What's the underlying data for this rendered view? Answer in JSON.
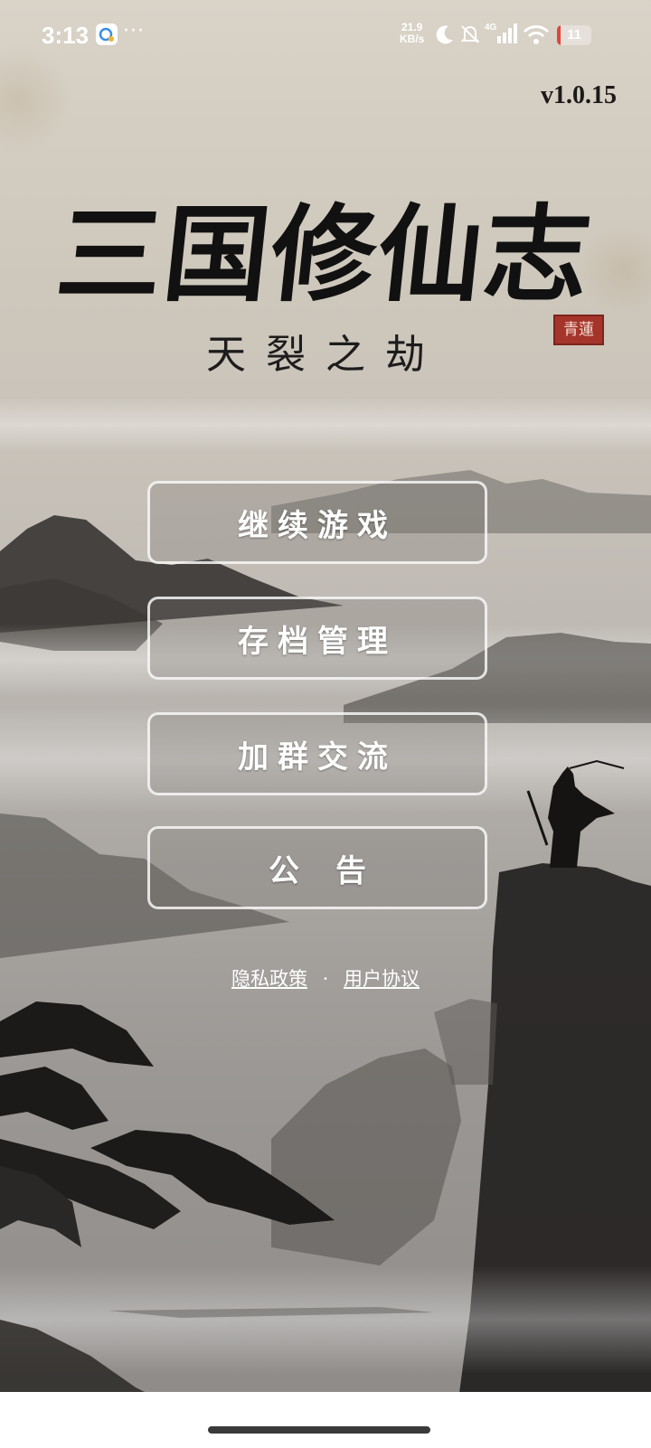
{
  "status_bar": {
    "time": "3:13",
    "dots": "···",
    "net_speed_value": "21.9",
    "net_speed_unit": "KB/s",
    "signal_label": "4G",
    "battery": "11",
    "battery_level_percent": 11,
    "battery_color": "#e0443a"
  },
  "version": "v1.0.15",
  "title": "三国修仙志",
  "subtitle": "天裂之劫",
  "seal": "青蓮",
  "menu": {
    "continue": "继续游戏",
    "saves": "存档管理",
    "join_group": "加群交流",
    "notice": "公告"
  },
  "links": {
    "privacy": "隐私政策",
    "separator": "·",
    "agreement": "用户协议"
  },
  "colors": {
    "accent_border": "#ffffff",
    "ink": "#111111",
    "seal": "#a5352b"
  }
}
